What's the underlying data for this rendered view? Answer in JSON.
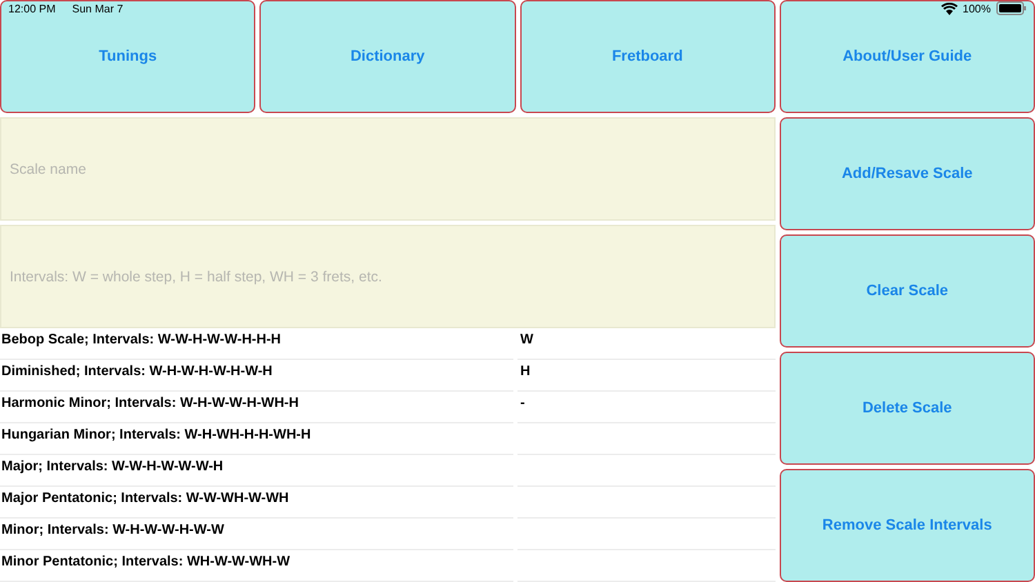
{
  "status_bar": {
    "time": "12:00 PM",
    "date": "Sun Mar 7",
    "battery": "100%"
  },
  "nav_buttons": [
    "Tunings",
    "Dictionary",
    "Fretboard",
    "About/User Guide"
  ],
  "fields": [
    {
      "placeholder": "Scale name"
    },
    {
      "placeholder": "Intervals: W = whole step, H = half step, WH = 3 frets, etc."
    }
  ],
  "action_buttons": [
    "Add/Resave Scale",
    "Clear Scale",
    "Delete Scale",
    "Remove Scale Intervals"
  ],
  "scales": [
    "Bebop Scale;  Intervals: W-W-H-W-W-H-H-H",
    "Diminished;  Intervals: W-H-W-H-W-H-W-H",
    "Harmonic Minor;  Intervals: W-H-W-W-H-WH-H",
    "Hungarian Minor;  Intervals: W-H-WH-H-H-WH-H",
    "Major;  Intervals: W-W-H-W-W-W-H",
    "Major Pentatonic;  Intervals: W-W-WH-W-WH",
    "Minor;  Intervals: W-H-W-W-H-W-W",
    "Minor Pentatonic;  Intervals: WH-W-W-WH-W"
  ],
  "intervals": [
    "W",
    "H",
    "-"
  ]
}
